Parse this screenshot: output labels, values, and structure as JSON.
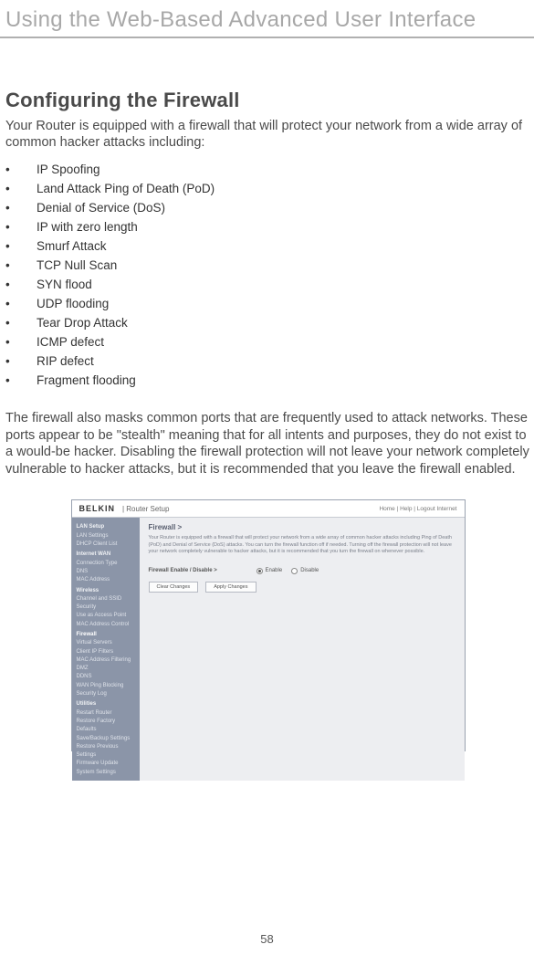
{
  "header": {
    "title": "Using the Web-Based Advanced User Interface"
  },
  "section": {
    "title": "Configuring the Firewall",
    "intro": "Your Router is equipped with a firewall that will protect your network from a wide array of common hacker attacks including:",
    "bullets": [
      "IP Spoofing",
      "Land Attack Ping of Death (PoD)",
      "Denial of Service (DoS)",
      "IP with zero length",
      "Smurf Attack",
      "TCP Null Scan",
      "SYN flood",
      "UDP flooding",
      "Tear Drop Attack",
      "ICMP defect",
      "RIP defect",
      "Fragment flooding"
    ],
    "para": "The firewall also masks common ports that are frequently used to attack networks. These ports appear to be \"stealth\" meaning that for all intents and purposes, they do not exist to a would-be hacker. Disabling the firewall protection will not leave your network completely vulnerable to hacker attacks, but it is recommended that you leave the firewall enabled."
  },
  "router_ui": {
    "brand": "BELKIN",
    "brand_sub": "Router Setup",
    "top_links": "Home | Help | Logout   Internet",
    "sidebar": {
      "groups": [
        {
          "header": "LAN Setup",
          "items": [
            "LAN Settings",
            "DHCP Client List"
          ]
        },
        {
          "header": "Internet WAN",
          "items": [
            "Connection Type",
            "DNS",
            "MAC Address"
          ]
        },
        {
          "header": "Wireless",
          "items": [
            "Channel and SSID",
            "Security",
            "Use as Access Point",
            "MAC Address Control"
          ]
        },
        {
          "header": "Firewall",
          "selected": true,
          "items": [
            "Virtual Servers",
            "Client IP Filters",
            "MAC Address Filtering",
            "DMZ",
            "DDNS",
            "WAN Ping Blocking",
            "Security Log"
          ]
        },
        {
          "header": "Utilities",
          "items": [
            "Restart Router",
            "Restore Factory Defaults",
            "Save/Backup Settings",
            "Restore Previous Settings",
            "Firmware Update",
            "System Settings"
          ]
        }
      ]
    },
    "main": {
      "title": "Firewall >",
      "desc": "Your Router is equipped with a firewall that will protect your network from a wide array of common hacker attacks including Ping of Death (PoD) and Denial of Service (DoS) attacks. You can turn the firewall function off if needed. Turning off the firewall protection will not leave your network completely vulnerable to hacker attacks, but it is recommended that you turn the firewall on whenever possible.",
      "setting_label": "Firewall Enable / Disable >",
      "radio_enable": "Enable",
      "radio_disable": "Disable",
      "btn_clear": "Clear Changes",
      "btn_apply": "Apply Changes"
    }
  },
  "page_number": "58"
}
